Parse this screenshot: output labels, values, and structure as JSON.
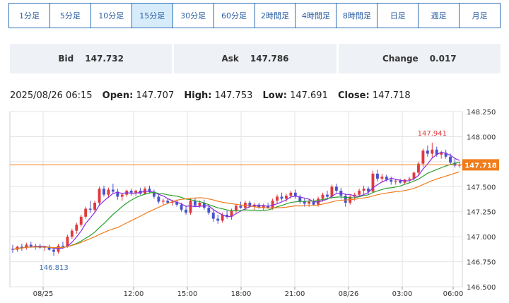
{
  "timeframes": [
    {
      "label": "1分足",
      "active": false
    },
    {
      "label": "5分足",
      "active": false
    },
    {
      "label": "10分足",
      "active": false
    },
    {
      "label": "15分足",
      "active": true
    },
    {
      "label": "30分足",
      "active": false
    },
    {
      "label": "60分足",
      "active": false
    },
    {
      "label": "2時間足",
      "active": false
    },
    {
      "label": "4時間足",
      "active": false
    },
    {
      "label": "8時間足",
      "active": false
    },
    {
      "label": "日足",
      "active": false
    },
    {
      "label": "週足",
      "active": false
    },
    {
      "label": "月足",
      "active": false
    }
  ],
  "quote": {
    "bid_label": "Bid",
    "bid": "147.732",
    "ask_label": "Ask",
    "ask": "147.786",
    "change_label": "Change",
    "change": "0.017"
  },
  "ohlc": {
    "datetime": "2025/08/26 06:15",
    "open_label": "Open:",
    "open": "147.707",
    "high_label": "High:",
    "high": "147.753",
    "low_label": "Low:",
    "low": "147.691",
    "close_label": "Close:",
    "close": "147.718"
  },
  "colors": {
    "up": "#e0393e",
    "down": "#4a52c9",
    "ma_short": "#8a2be2",
    "ma_mid": "#2ca02c",
    "ma_long": "#f07c1b",
    "last_price": "#f07c1b",
    "grid": "#e3e3e3"
  },
  "chart_data": {
    "type": "candlestick",
    "y_ticks": [
      "148.250",
      "148.000",
      "147.750",
      "147.500",
      "147.250",
      "147.000",
      "146.750",
      "146.500"
    ],
    "ylim": [
      146.5,
      148.25
    ],
    "x_ticks": [
      "08/25",
      "12:00",
      "15:00",
      "18:00",
      "21:00",
      "08/26",
      "03:00",
      "06:00"
    ],
    "last_price": "147.718",
    "max_annotation": "147.941",
    "min_annotation": "146.813",
    "candles_ohlc": [
      [
        146.88,
        146.92,
        146.84,
        146.87
      ],
      [
        146.87,
        146.91,
        146.85,
        146.9
      ],
      [
        146.9,
        146.93,
        146.86,
        146.89
      ],
      [
        146.89,
        146.94,
        146.87,
        146.92
      ],
      [
        146.92,
        146.95,
        146.89,
        146.9
      ],
      [
        146.9,
        146.93,
        146.87,
        146.91
      ],
      [
        146.91,
        146.93,
        146.88,
        146.89
      ],
      [
        146.89,
        146.91,
        146.86,
        146.9
      ],
      [
        146.9,
        146.92,
        146.86,
        146.87
      ],
      [
        146.87,
        146.89,
        146.81,
        146.85
      ],
      [
        146.85,
        146.93,
        146.83,
        146.91
      ],
      [
        146.91,
        146.95,
        146.88,
        146.9
      ],
      [
        146.9,
        147.02,
        146.89,
        147.0
      ],
      [
        147.0,
        147.08,
        146.98,
        147.06
      ],
      [
        147.06,
        147.14,
        147.03,
        147.12
      ],
      [
        147.12,
        147.22,
        147.1,
        147.2
      ],
      [
        147.2,
        147.3,
        147.18,
        147.28
      ],
      [
        147.28,
        147.36,
        147.24,
        147.27
      ],
      [
        147.27,
        147.36,
        147.25,
        147.34
      ],
      [
        147.34,
        147.5,
        147.32,
        147.48
      ],
      [
        147.48,
        147.51,
        147.4,
        147.42
      ],
      [
        147.42,
        147.49,
        147.39,
        147.47
      ],
      [
        147.47,
        147.53,
        147.43,
        147.45
      ],
      [
        147.45,
        147.48,
        147.37,
        147.4
      ],
      [
        147.4,
        147.44,
        147.36,
        147.42
      ],
      [
        147.42,
        147.47,
        147.4,
        147.46
      ],
      [
        147.46,
        147.48,
        147.41,
        147.44
      ],
      [
        147.44,
        147.47,
        147.41,
        147.46
      ],
      [
        147.46,
        147.49,
        147.42,
        147.43
      ],
      [
        147.43,
        147.5,
        147.42,
        147.48
      ],
      [
        147.48,
        147.51,
        147.43,
        147.45
      ],
      [
        147.45,
        147.47,
        147.38,
        147.4
      ],
      [
        147.4,
        147.42,
        147.33,
        147.35
      ],
      [
        147.35,
        147.38,
        147.32,
        147.36
      ],
      [
        147.36,
        147.38,
        147.33,
        147.34
      ],
      [
        147.34,
        147.37,
        147.31,
        147.35
      ],
      [
        147.35,
        147.37,
        147.3,
        147.32
      ],
      [
        147.32,
        147.34,
        147.25,
        147.27
      ],
      [
        147.27,
        147.31,
        147.22,
        147.24
      ],
      [
        147.24,
        147.38,
        147.22,
        147.36
      ],
      [
        147.36,
        147.39,
        147.3,
        147.31
      ],
      [
        147.31,
        147.36,
        147.29,
        147.34
      ],
      [
        147.34,
        147.37,
        147.27,
        147.29
      ],
      [
        147.29,
        147.32,
        147.22,
        147.24
      ],
      [
        147.24,
        147.27,
        147.15,
        147.18
      ],
      [
        147.18,
        147.22,
        147.13,
        147.16
      ],
      [
        147.16,
        147.24,
        147.14,
        147.22
      ],
      [
        147.22,
        147.27,
        147.18,
        147.2
      ],
      [
        147.2,
        147.28,
        147.17,
        147.26
      ],
      [
        147.26,
        147.33,
        147.24,
        147.31
      ],
      [
        147.31,
        147.35,
        147.28,
        147.29
      ],
      [
        147.29,
        147.36,
        147.26,
        147.34
      ],
      [
        147.34,
        147.36,
        147.29,
        147.3
      ],
      [
        147.3,
        147.34,
        147.27,
        147.32
      ],
      [
        147.32,
        147.34,
        147.28,
        147.29
      ],
      [
        147.29,
        147.33,
        147.26,
        147.31
      ],
      [
        147.31,
        147.34,
        147.28,
        147.29
      ],
      [
        147.29,
        147.38,
        147.27,
        147.36
      ],
      [
        147.36,
        147.42,
        147.33,
        147.4
      ],
      [
        147.4,
        147.44,
        147.36,
        147.38
      ],
      [
        147.38,
        147.43,
        147.35,
        147.41
      ],
      [
        147.41,
        147.46,
        147.38,
        147.44
      ],
      [
        147.44,
        147.47,
        147.38,
        147.4
      ],
      [
        147.4,
        147.42,
        147.33,
        147.35
      ],
      [
        147.35,
        147.38,
        147.3,
        147.33
      ],
      [
        147.33,
        147.37,
        147.3,
        147.35
      ],
      [
        147.35,
        147.38,
        147.31,
        147.32
      ],
      [
        147.32,
        147.4,
        147.3,
        147.38
      ],
      [
        147.38,
        147.44,
        147.35,
        147.42
      ],
      [
        147.42,
        147.46,
        147.38,
        147.4
      ],
      [
        147.4,
        147.52,
        147.38,
        147.5
      ],
      [
        147.5,
        147.53,
        147.44,
        147.46
      ],
      [
        147.46,
        147.49,
        147.38,
        147.41
      ],
      [
        147.41,
        147.43,
        147.3,
        147.34
      ],
      [
        147.34,
        147.42,
        147.32,
        147.4
      ],
      [
        147.4,
        147.44,
        147.36,
        147.42
      ],
      [
        147.42,
        147.48,
        147.4,
        147.46
      ],
      [
        147.46,
        147.51,
        147.42,
        147.48
      ],
      [
        147.48,
        147.5,
        147.42,
        147.45
      ],
      [
        147.45,
        147.66,
        147.44,
        147.63
      ],
      [
        147.63,
        147.67,
        147.55,
        147.58
      ],
      [
        147.58,
        147.63,
        147.54,
        147.6
      ],
      [
        147.6,
        147.62,
        147.55,
        147.57
      ],
      [
        147.57,
        147.6,
        147.52,
        147.55
      ],
      [
        147.55,
        147.58,
        147.52,
        147.56
      ],
      [
        147.56,
        147.58,
        147.53,
        147.54
      ],
      [
        147.54,
        147.58,
        147.52,
        147.57
      ],
      [
        147.57,
        147.6,
        147.54,
        147.58
      ],
      [
        147.58,
        147.65,
        147.56,
        147.64
      ],
      [
        147.64,
        147.75,
        147.62,
        147.73
      ],
      [
        147.73,
        147.88,
        147.7,
        147.86
      ],
      [
        147.86,
        147.91,
        147.8,
        147.83
      ],
      [
        147.83,
        147.94,
        147.79,
        147.87
      ],
      [
        147.87,
        147.9,
        147.8,
        147.82
      ],
      [
        147.82,
        147.86,
        147.78,
        147.84
      ],
      [
        147.84,
        147.87,
        147.78,
        147.8
      ],
      [
        147.8,
        147.83,
        147.72,
        147.74
      ],
      [
        147.74,
        147.78,
        147.69,
        147.71
      ],
      [
        147.71,
        147.75,
        147.69,
        147.72
      ]
    ]
  }
}
